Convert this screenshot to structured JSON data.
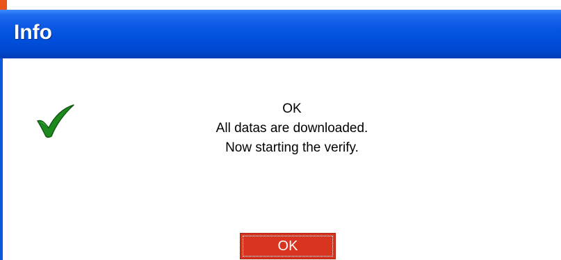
{
  "window": {
    "title": "Info"
  },
  "dialog": {
    "icon": "checkmark-icon",
    "message_lines": [
      "OK",
      "All datas are downloaded.",
      "Now starting the verify."
    ],
    "ok_button_label": "OK"
  },
  "colors": {
    "titlebar": "#0050dc",
    "button": "#d8341f",
    "checkmark": "#1e8a1e"
  }
}
